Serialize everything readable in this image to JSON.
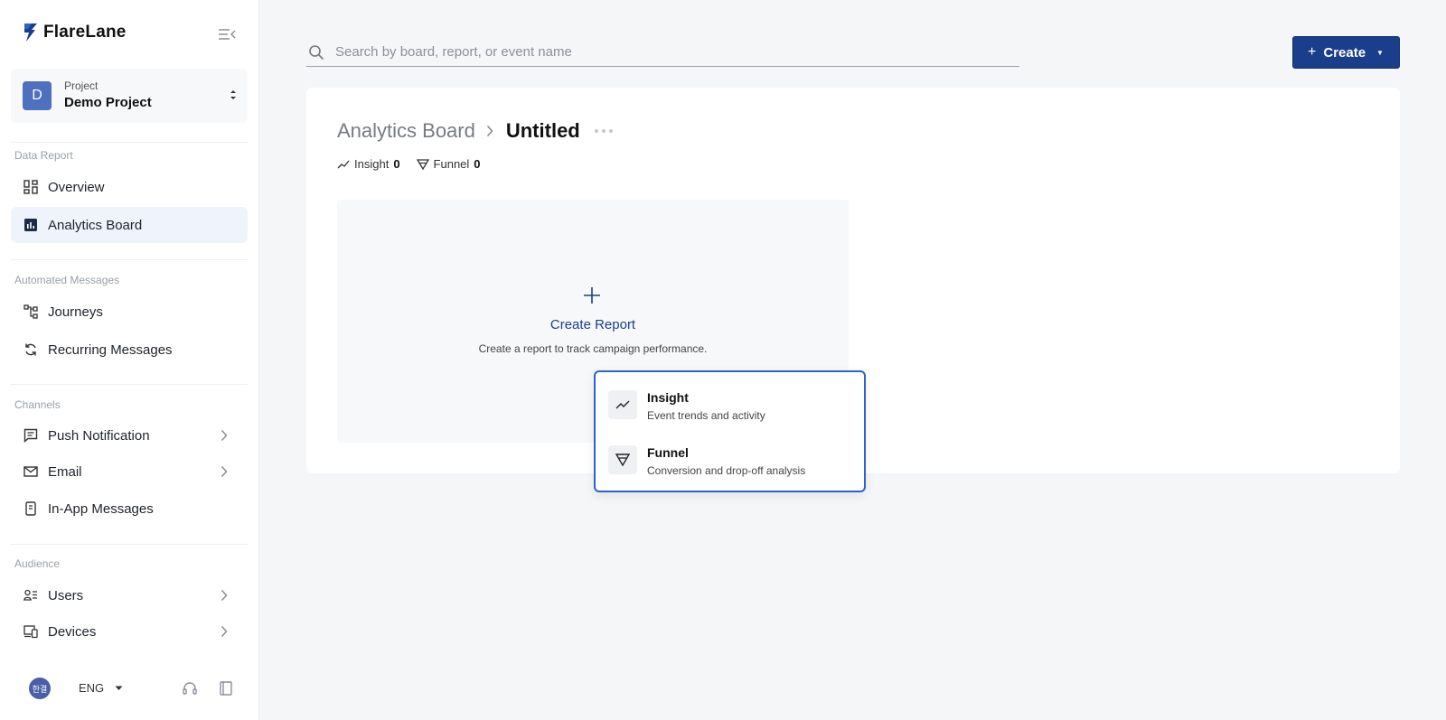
{
  "app": {
    "name": "FlareLane"
  },
  "project": {
    "label": "Project",
    "name": "Demo Project",
    "initial": "D"
  },
  "sidebar": {
    "sections": [
      {
        "title": "Data Report"
      },
      {
        "title": "Automated Messages"
      },
      {
        "title": "Channels"
      },
      {
        "title": "Audience"
      }
    ],
    "items": [
      {
        "label": "Overview",
        "icon": "grid-icon"
      },
      {
        "label": "Analytics Board",
        "icon": "bar-chart-icon",
        "active": true
      },
      {
        "label": "Journeys",
        "icon": "journey-icon"
      },
      {
        "label": "Recurring Messages",
        "icon": "refresh-icon"
      },
      {
        "label": "Push Notification",
        "icon": "message-icon",
        "has_submenu": true
      },
      {
        "label": "Email",
        "icon": "mail-icon",
        "has_submenu": true
      },
      {
        "label": "In-App Messages",
        "icon": "mobile-icon"
      },
      {
        "label": "Users",
        "icon": "users-icon",
        "has_submenu": true
      },
      {
        "label": "Devices",
        "icon": "devices-icon",
        "has_submenu": true
      }
    ]
  },
  "footer": {
    "user_initials": "한결",
    "language": "ENG"
  },
  "search": {
    "placeholder": "Search by board, report, or event name"
  },
  "create_button": {
    "label": "Create"
  },
  "breadcrumb": {
    "parent": "Analytics Board",
    "current": "Untitled"
  },
  "stats": {
    "insight": {
      "label": "Insight",
      "count": "0"
    },
    "funnel": {
      "label": "Funnel",
      "count": "0"
    }
  },
  "empty_state": {
    "title": "Create Report",
    "subtitle": "Create a report to track campaign performance."
  },
  "dropdown": {
    "items": [
      {
        "title": "Insight",
        "description": "Event trends and activity",
        "icon": "trend-icon"
      },
      {
        "title": "Funnel",
        "description": "Conversion and drop-off analysis",
        "icon": "funnel-icon"
      }
    ]
  },
  "colors": {
    "primary": "#1a3e8c",
    "active_bg": "#eff3fb",
    "focus_border": "#2f63c9"
  }
}
